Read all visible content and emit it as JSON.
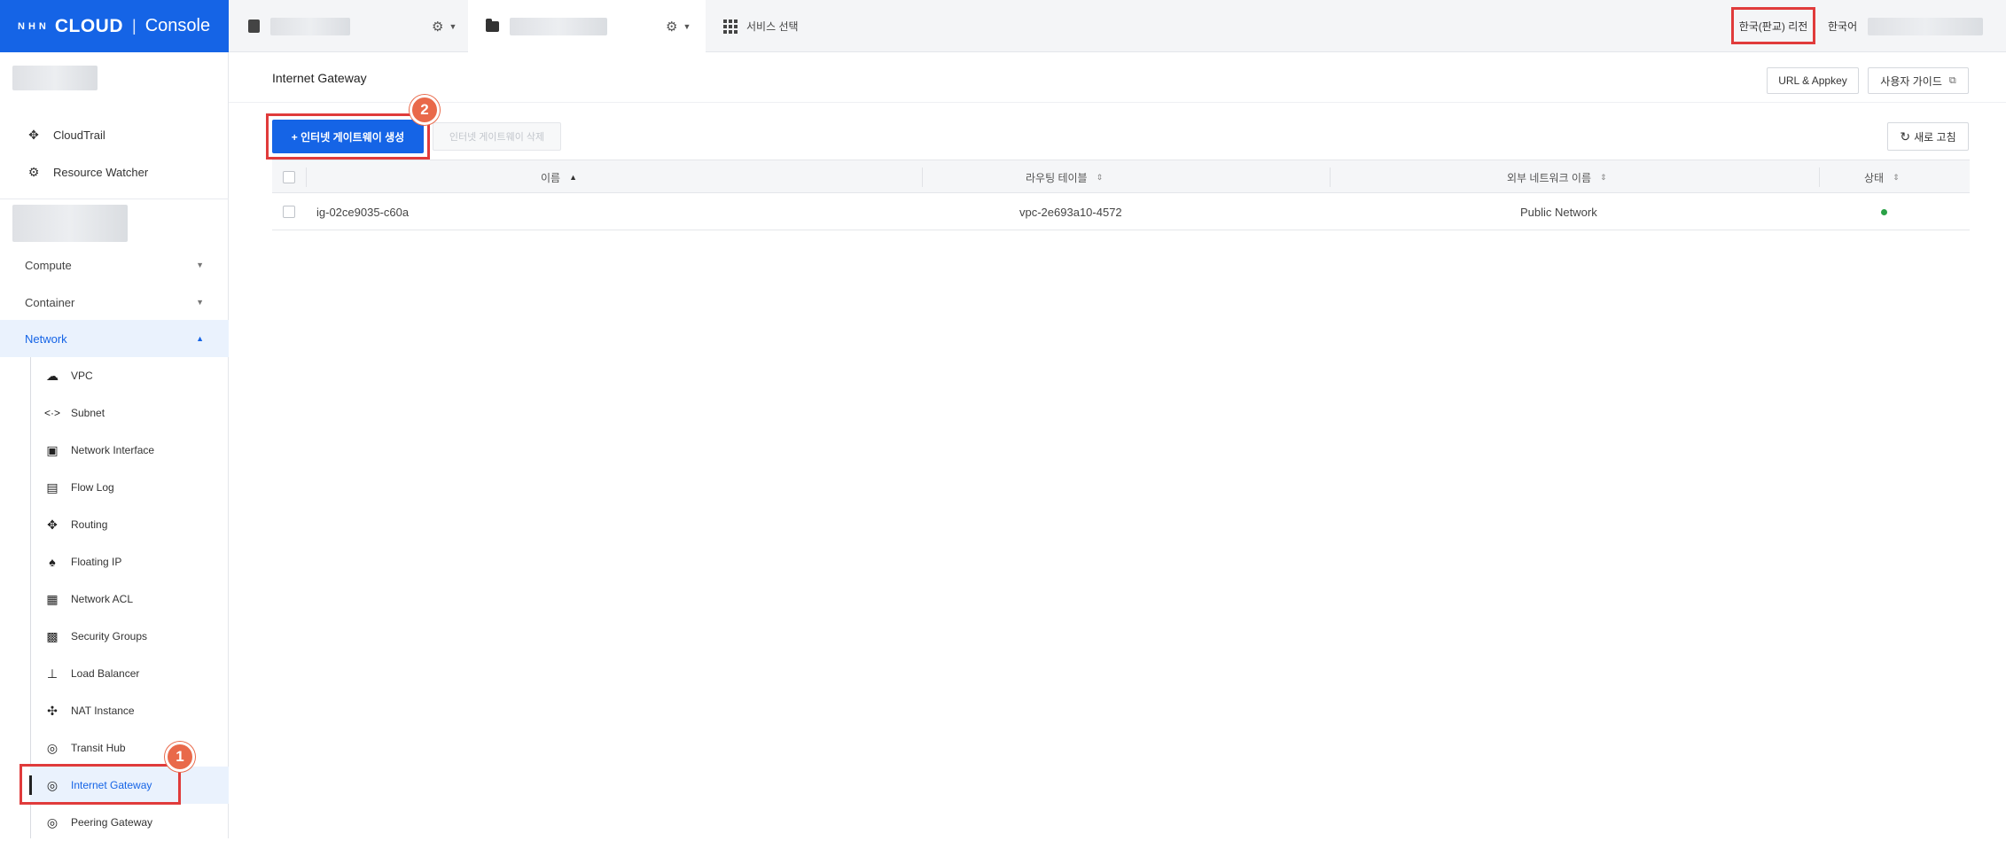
{
  "header": {
    "logo_nhn": "NHN",
    "logo_cloud": "CLOUD",
    "logo_console": "Console",
    "service_select": "서비스 선택",
    "region": "한국(판교) 리전",
    "language": "한국어"
  },
  "sidebar": {
    "top_items": [
      {
        "label": "CloudTrail",
        "icon": "cloudtrail-icon"
      },
      {
        "label": "Resource Watcher",
        "icon": "resource-watcher-icon"
      }
    ],
    "categories": [
      {
        "label": "Compute",
        "expanded": false
      },
      {
        "label": "Container",
        "expanded": false
      },
      {
        "label": "Network",
        "expanded": true
      }
    ],
    "network_items": [
      {
        "label": "VPC",
        "icon": "cloud-icon"
      },
      {
        "label": "Subnet",
        "icon": "subnet-icon"
      },
      {
        "label": "Network Interface",
        "icon": "network-interface-icon"
      },
      {
        "label": "Flow Log",
        "icon": "flow-log-icon"
      },
      {
        "label": "Routing",
        "icon": "routing-icon"
      },
      {
        "label": "Floating IP",
        "icon": "floating-ip-icon"
      },
      {
        "label": "Network ACL",
        "icon": "network-acl-icon"
      },
      {
        "label": "Security Groups",
        "icon": "security-groups-icon"
      },
      {
        "label": "Load Balancer",
        "icon": "load-balancer-icon"
      },
      {
        "label": "NAT Instance",
        "icon": "nat-instance-icon"
      },
      {
        "label": "Transit Hub",
        "icon": "transit-hub-icon"
      },
      {
        "label": "Internet Gateway",
        "icon": "internet-gateway-icon",
        "active": true
      },
      {
        "label": "Peering Gateway",
        "icon": "peering-gateway-icon"
      }
    ]
  },
  "main": {
    "title": "Internet Gateway",
    "url_appkey": "URL & Appkey",
    "user_guide": "사용자 가이드",
    "create_button": "+ 인터넷 게이트웨이 생성",
    "delete_button": "인터넷 게이트웨이 삭제",
    "refresh_button": "새로 고침",
    "table": {
      "headers": [
        "이름",
        "라우팅 테이블",
        "외부 네트워크 이름",
        "상태"
      ],
      "rows": [
        {
          "name": "ig-02ce9035-c60a",
          "routing_table": "vpc-2e693a10-4572",
          "external_network": "Public Network",
          "status": "active"
        }
      ]
    }
  },
  "annotations": {
    "step1": "1",
    "step2": "2"
  },
  "colors": {
    "brand": "#1564e6",
    "annotation_red": "#e03b3b",
    "badge_orange": "#e9694a",
    "status_green": "#2aa146"
  }
}
